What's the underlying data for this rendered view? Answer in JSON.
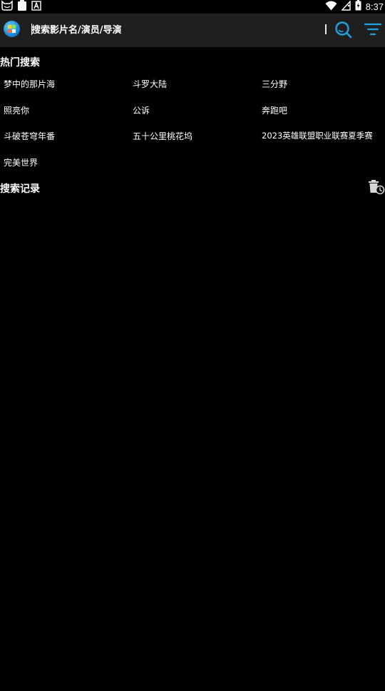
{
  "status_bar": {
    "time": "8:37",
    "left_icons": [
      "notification-cat-icon",
      "clipboard-icon",
      "a-letter-icon"
    ],
    "right_icons": [
      "wifi-icon",
      "sim-no-signal-icon",
      "battery-icon"
    ]
  },
  "header": {
    "search_placeholder": "搜索影片名/演员/导演",
    "icons": [
      "app-logo-icon",
      "search-icon",
      "filter-icon"
    ],
    "accent_color": "#1fa3e0"
  },
  "hot_search": {
    "title": "热门搜索",
    "items": [
      "梦中的那片海",
      "斗罗大陆",
      "三分野",
      "照亮你",
      "公诉",
      "奔跑吧",
      "斗破苍穹年番",
      "五十公里桃花坞",
      "2023英雄联盟职业联赛夏季赛",
      "完美世界"
    ]
  },
  "history": {
    "title": "搜索记录",
    "clear_icon": "trash-clock-icon"
  }
}
